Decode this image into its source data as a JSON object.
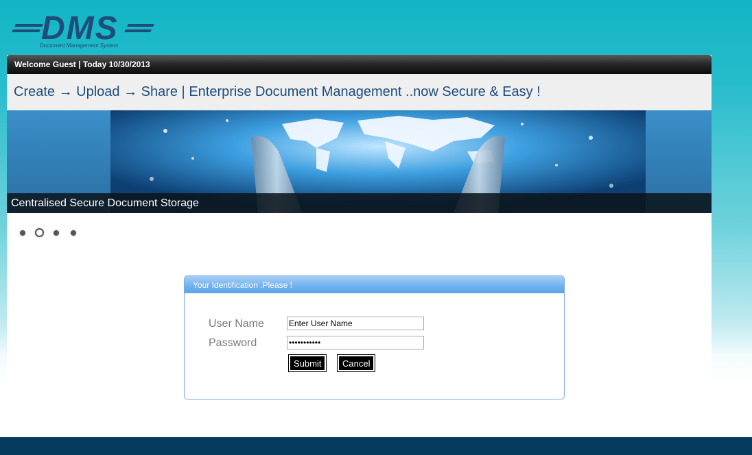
{
  "logo": {
    "brand": "DMS",
    "subtitle": "Document Management System"
  },
  "welcome_bar": {
    "text": "Welcome Guest | Today  10/30/2013"
  },
  "tagline": "Create → Upload → Share | Enterprise Document Management ..now Secure & Easy !",
  "banner": {
    "caption": "Centralised Secure Document Storage",
    "slides": 4,
    "active_slide": 2
  },
  "login": {
    "header": "Your Identification .Please !",
    "username_label": "User Name",
    "username_value": "Enter User Name",
    "password_label": "Password",
    "password_value": "•••••••••••",
    "submit_label": "Submit",
    "cancel_label": "Cancel"
  },
  "colors": {
    "brand_blue": "#1e4d7a",
    "login_header": "#6fb0ee",
    "footer": "#053c5e"
  }
}
